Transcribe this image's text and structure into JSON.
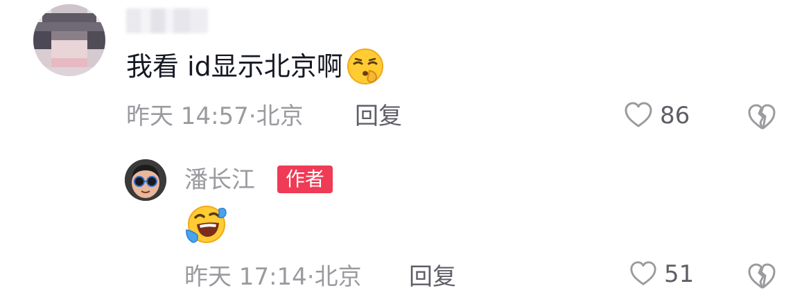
{
  "comment": {
    "username_blurred": "",
    "text": "我看 id显示北京啊",
    "emoji": "smirking-pouting-emoji",
    "time": "昨天 14:57·北京",
    "reply_label": "回复",
    "likes": "86"
  },
  "reply": {
    "author": "潘长江",
    "badge": "作者",
    "emoji": "laughing-crying-emoji",
    "time": "昨天 17:14·北京",
    "reply_label": "回复",
    "likes": "51"
  },
  "colors": {
    "badge": "#ef3b55",
    "meta_text": "#9a9a9f",
    "action_text": "#5e5e66"
  }
}
